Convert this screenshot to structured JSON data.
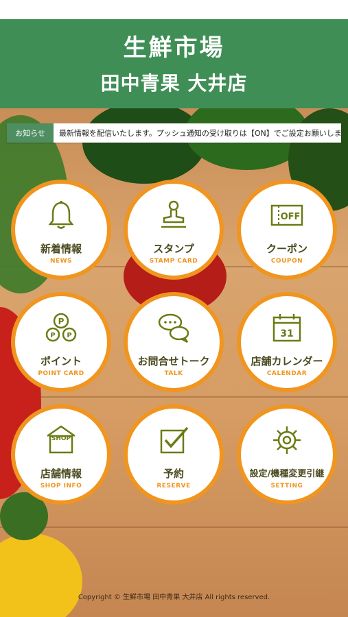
{
  "header": {
    "title_line1": "生鮮市場",
    "title_line2": "田中青果 大井店"
  },
  "notice": {
    "badge": "お知らせ",
    "text": "最新情報を配信いたします。プッシュ通知の受け取りは【ON】でご設定お願いします。"
  },
  "menu": [
    {
      "label": "新着情報",
      "sub": "NEWS",
      "icon": "bell-icon"
    },
    {
      "label": "スタンプ",
      "sub": "STAMP CARD",
      "icon": "stamp-icon"
    },
    {
      "label": "クーポン",
      "sub": "COUPON",
      "icon": "coupon-off-icon",
      "icon_text": "OFF"
    },
    {
      "label": "ポイント",
      "sub": "POINT CARD",
      "icon": "points-icon",
      "icon_text": "P"
    },
    {
      "label": "お問合せトーク",
      "sub": "TALK",
      "icon": "chat-bubbles-icon"
    },
    {
      "label": "店舗カレンダー",
      "sub": "CALENDAR",
      "icon": "calendar-icon",
      "icon_text": "31"
    },
    {
      "label": "店舗情報",
      "sub": "SHOP INFO",
      "icon": "shop-icon",
      "icon_text": "SHOP"
    },
    {
      "label": "予約",
      "sub": "RESERVE",
      "icon": "checkbox-icon"
    },
    {
      "label": "設定/機種変更引継",
      "sub": "SETTING",
      "icon": "gear-icon"
    }
  ],
  "footer": {
    "copyright": "Copyright © 生鮮市場 田中青果 大井店 All rights reserved."
  },
  "colors": {
    "header_green": "#3f8e56",
    "tile_orange": "#f0951f",
    "icon_olive": "#6b7a14",
    "label_text": "#4a4a1e"
  }
}
